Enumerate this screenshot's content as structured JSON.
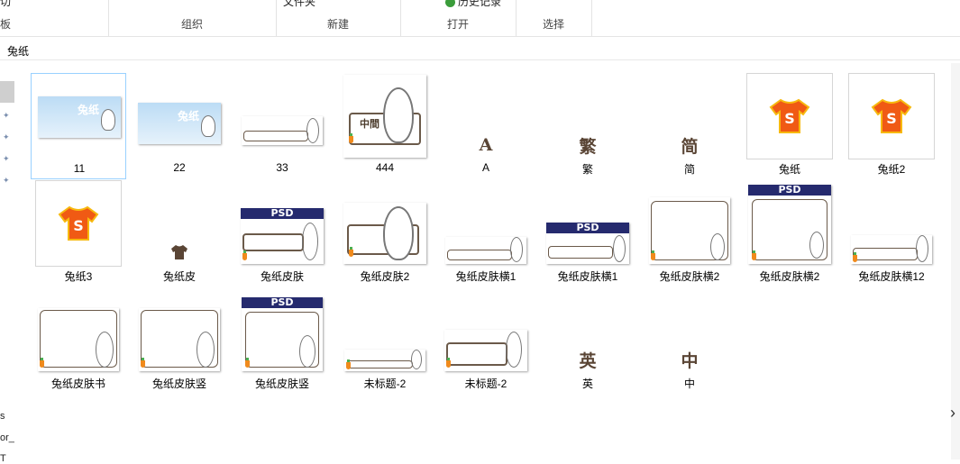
{
  "ribbon": {
    "groups": [
      {
        "label": "板",
        "top": "切"
      },
      {
        "label": "组织",
        "top": ""
      },
      {
        "label": "新建",
        "top": "文件夹"
      },
      {
        "label": "打开",
        "top": "历史记录"
      },
      {
        "label": "选择",
        "top": ""
      }
    ]
  },
  "address": {
    "path": "兔纸"
  },
  "nav": {
    "texts": [
      "s",
      "or_",
      "T"
    ]
  },
  "files": [
    {
      "name": "11"
    },
    {
      "name": "22"
    },
    {
      "name": "33"
    },
    {
      "name": "444"
    },
    {
      "name": "A",
      "glyph": "A"
    },
    {
      "name": "繁",
      "glyph": "繁"
    },
    {
      "name": "简",
      "glyph": "简"
    },
    {
      "name": "兔纸"
    },
    {
      "name": "兔纸2"
    },
    {
      "name": "兔纸3"
    },
    {
      "name": "兔纸皮"
    },
    {
      "name": "兔纸皮肤",
      "psd": "PSD"
    },
    {
      "name": "兔纸皮肤2"
    },
    {
      "name": "兔纸皮肤横1"
    },
    {
      "name": "兔纸皮肤横1",
      "psd": "PSD"
    },
    {
      "name": "兔纸皮肤横2"
    },
    {
      "name": "兔纸皮肤横2",
      "psd": "PSD"
    },
    {
      "name": "兔纸皮肤横12"
    },
    {
      "name": "兔纸皮肤书"
    },
    {
      "name": "兔纸皮肤竖"
    },
    {
      "name": "兔纸皮肤竖",
      "psd": "PSD"
    },
    {
      "name": "未标题-2"
    },
    {
      "name": "未标题-2"
    },
    {
      "name": "英",
      "glyph": "英"
    },
    {
      "name": "中",
      "glyph": "中"
    }
  ],
  "thumbtext": {
    "logo": "兔纸",
    "box": "中間"
  },
  "colors": {
    "selection": "#99d1ff",
    "psd": "#252a6e",
    "shirt": "#f05a14"
  }
}
